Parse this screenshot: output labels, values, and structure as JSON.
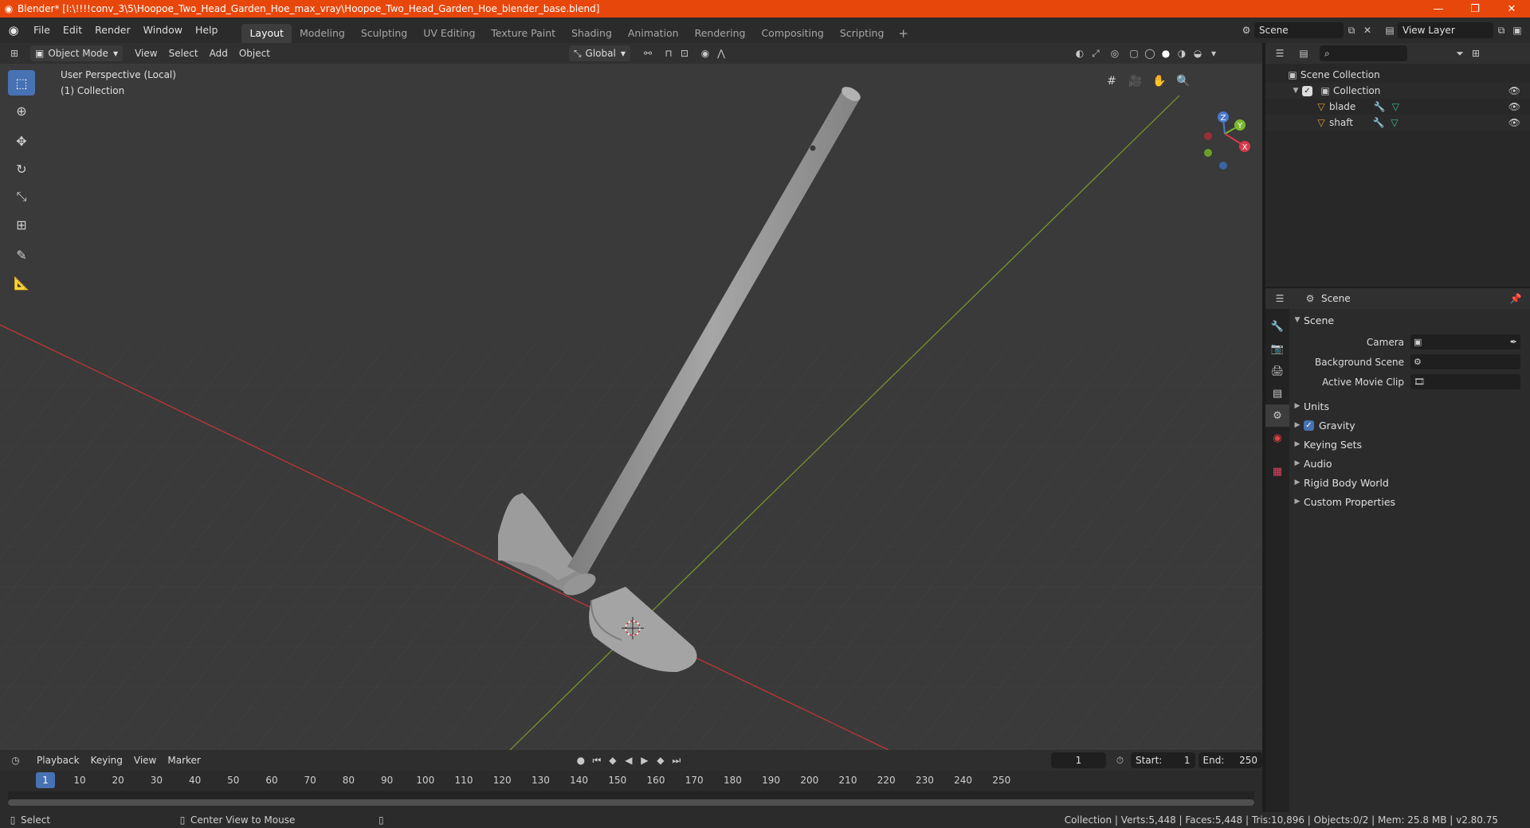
{
  "window": {
    "title": "Blender* [I:\\!!!!conv_3\\5\\Hoopoe_Two_Head_Garden_Hoe_max_vray\\Hoopoe_Two_Head_Garden_Hoe_blender_base.blend]"
  },
  "menu": [
    "File",
    "Edit",
    "Render",
    "Window",
    "Help"
  ],
  "workspaces": [
    "Layout",
    "Modeling",
    "Sculpting",
    "UV Editing",
    "Texture Paint",
    "Shading",
    "Animation",
    "Rendering",
    "Compositing",
    "Scripting"
  ],
  "top_right": {
    "scene": "Scene",
    "view_layer": "View Layer"
  },
  "viewport": {
    "mode": "Object Mode",
    "menus": [
      "View",
      "Select",
      "Add",
      "Object"
    ],
    "orientation": "Global",
    "info_line1": "User Perspective (Local)",
    "info_line2": "(1) Collection"
  },
  "gizmo": {
    "z": "Z",
    "y": "Y",
    "x": "X"
  },
  "outliner": {
    "root": "Scene Collection",
    "collection": "Collection",
    "objects": [
      "blade",
      "shaft"
    ]
  },
  "properties": {
    "header": "Scene",
    "panel": "Scene",
    "camera_label": "Camera",
    "background_scene_label": "Background Scene",
    "active_movie_clip_label": "Active Movie Clip",
    "subpanels": [
      "Units",
      "Gravity",
      "Keying Sets",
      "Audio",
      "Rigid Body World",
      "Custom Properties"
    ]
  },
  "timeline": {
    "menus": [
      "Playback",
      "Keying",
      "View",
      "Marker"
    ],
    "current_frame": "1",
    "start_label": "Start:",
    "start": "1",
    "end_label": "End:",
    "end": "250",
    "ruler": [
      "10",
      "20",
      "30",
      "40",
      "50",
      "60",
      "70",
      "80",
      "90",
      "100",
      "110",
      "120",
      "130",
      "140",
      "150",
      "160",
      "170",
      "180",
      "190",
      "200",
      "210",
      "220",
      "230",
      "240",
      "250"
    ],
    "ruler_current": "1"
  },
  "status": {
    "left": "Select",
    "middle": "Center View to Mouse",
    "right": "Collection | Verts:5,448 | Faces:5,448 | Tris:10,896 | Objects:0/2 | Mem: 25.8 MB | v2.80.75"
  },
  "colors": {
    "titlebar": "#e8470c",
    "accent": "#4772b3",
    "viewport_bg": "#3a3a3a",
    "x_axis": "#c03535",
    "y_axis": "#7a9a2a",
    "mesh": "#9a9a9a",
    "object_icon": "#e8a13a",
    "modifier_icon": "#5aa0e8",
    "mesh_data_icon": "#3ec08a"
  }
}
